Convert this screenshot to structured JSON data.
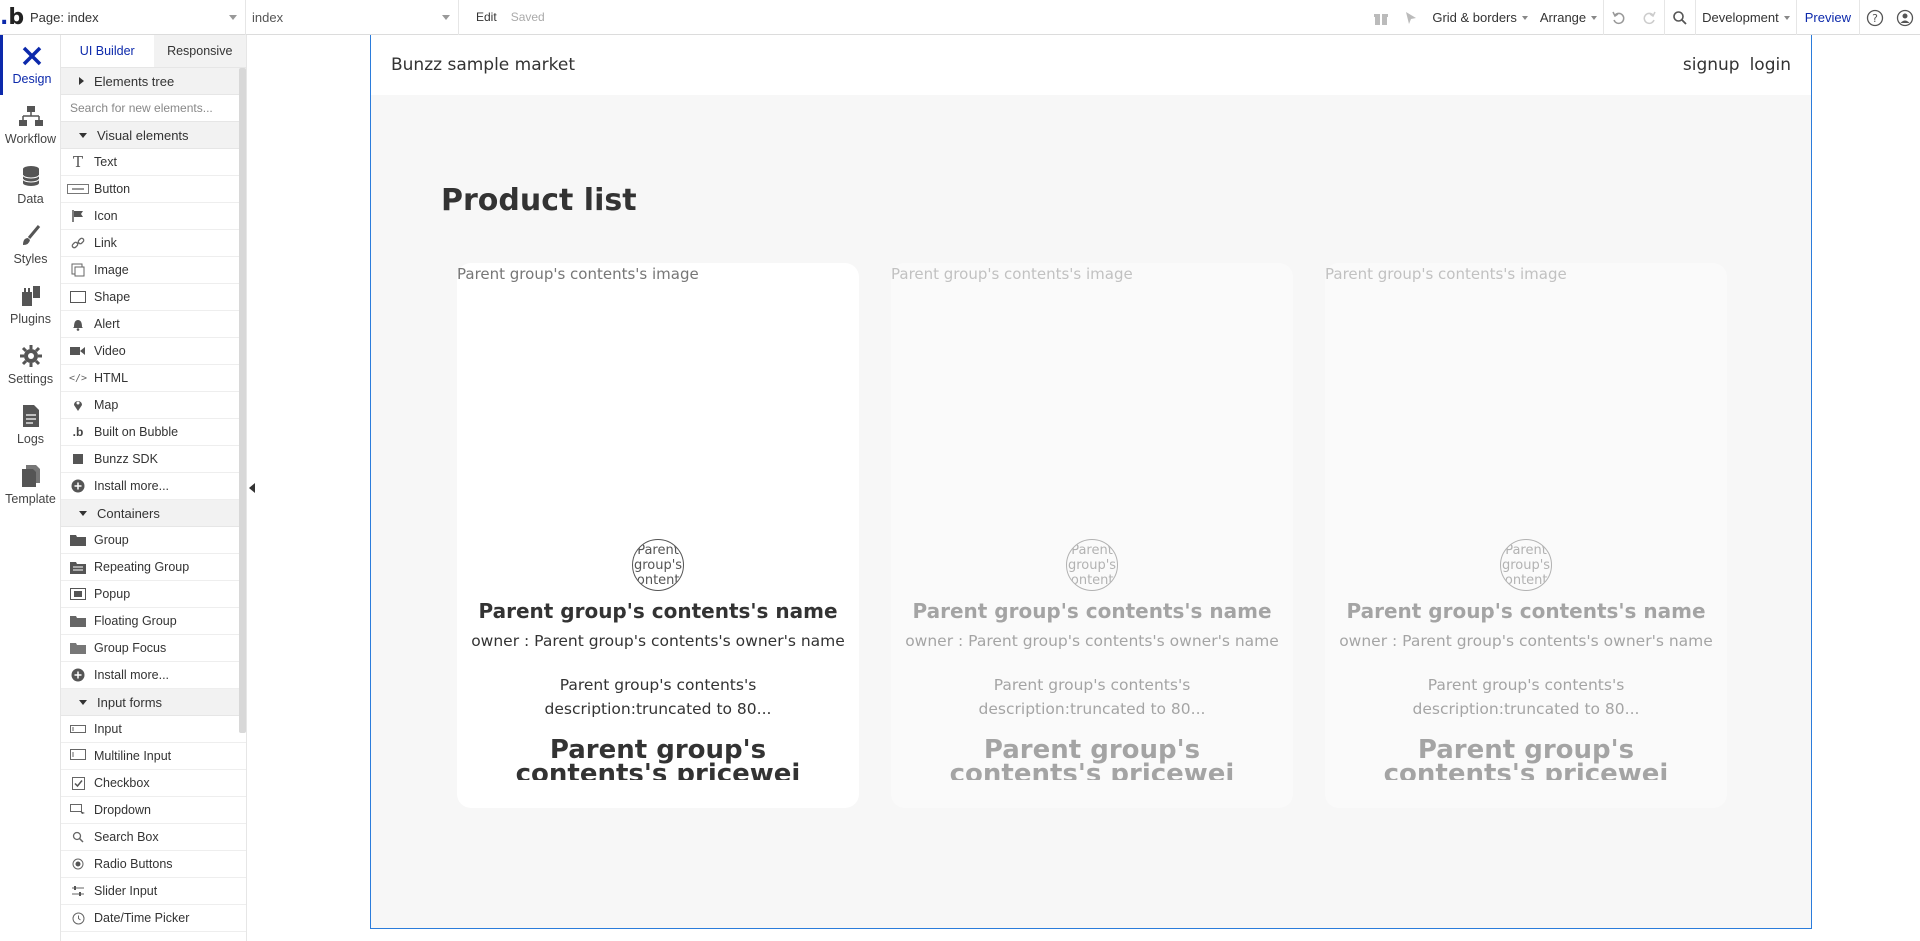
{
  "topbar": {
    "logo": ".b",
    "page_select": "Page: index",
    "index_select": "index",
    "edit": "Edit",
    "saved": "Saved",
    "grid_borders": "Grid & borders",
    "arrange": "Arrange",
    "environment": "Development",
    "preview": "Preview"
  },
  "leftnav": {
    "items": [
      {
        "label": "Design",
        "icon": "design-icon"
      },
      {
        "label": "Workflow",
        "icon": "workflow-icon"
      },
      {
        "label": "Data",
        "icon": "database-icon"
      },
      {
        "label": "Styles",
        "icon": "brush-icon"
      },
      {
        "label": "Plugins",
        "icon": "plug-icon"
      },
      {
        "label": "Settings",
        "icon": "gear-icon"
      },
      {
        "label": "Logs",
        "icon": "document-icon"
      },
      {
        "label": "Template",
        "icon": "template-icon"
      }
    ]
  },
  "palette": {
    "tab_ui_builder": "UI Builder",
    "tab_responsive": "Responsive",
    "elements_tree": "Elements tree",
    "search_placeholder": "Search for new elements...",
    "visual_heading": "Visual elements",
    "visual_items": [
      "Text",
      "Button",
      "Icon",
      "Link",
      "Image",
      "Shape",
      "Alert",
      "Video",
      "HTML",
      "Map",
      "Built on Bubble",
      "Bunzz SDK",
      "Install more..."
    ],
    "containers_heading": "Containers",
    "container_items": [
      "Group",
      "Repeating Group",
      "Popup",
      "Floating Group",
      "Group Focus",
      "Install more..."
    ],
    "inputs_heading": "Input forms",
    "input_items": [
      "Input",
      "Multiline Input",
      "Checkbox",
      "Dropdown",
      "Search Box",
      "Radio Buttons",
      "Slider Input",
      "Date/Time Picker"
    ]
  },
  "canvas": {
    "brand": "Bunzz sample market",
    "signup": "signup",
    "login": "login",
    "title": "Product list",
    "card": {
      "image_alt": "Parent group's contents's image",
      "avatar_text": "Parent group's contents",
      "name": "Parent group's contents's name",
      "owner": "owner : Parent group's contents's owner's name",
      "description": "Parent group's contents's description:truncated to 80...",
      "price": "Parent group's contents's pricewei"
    }
  }
}
